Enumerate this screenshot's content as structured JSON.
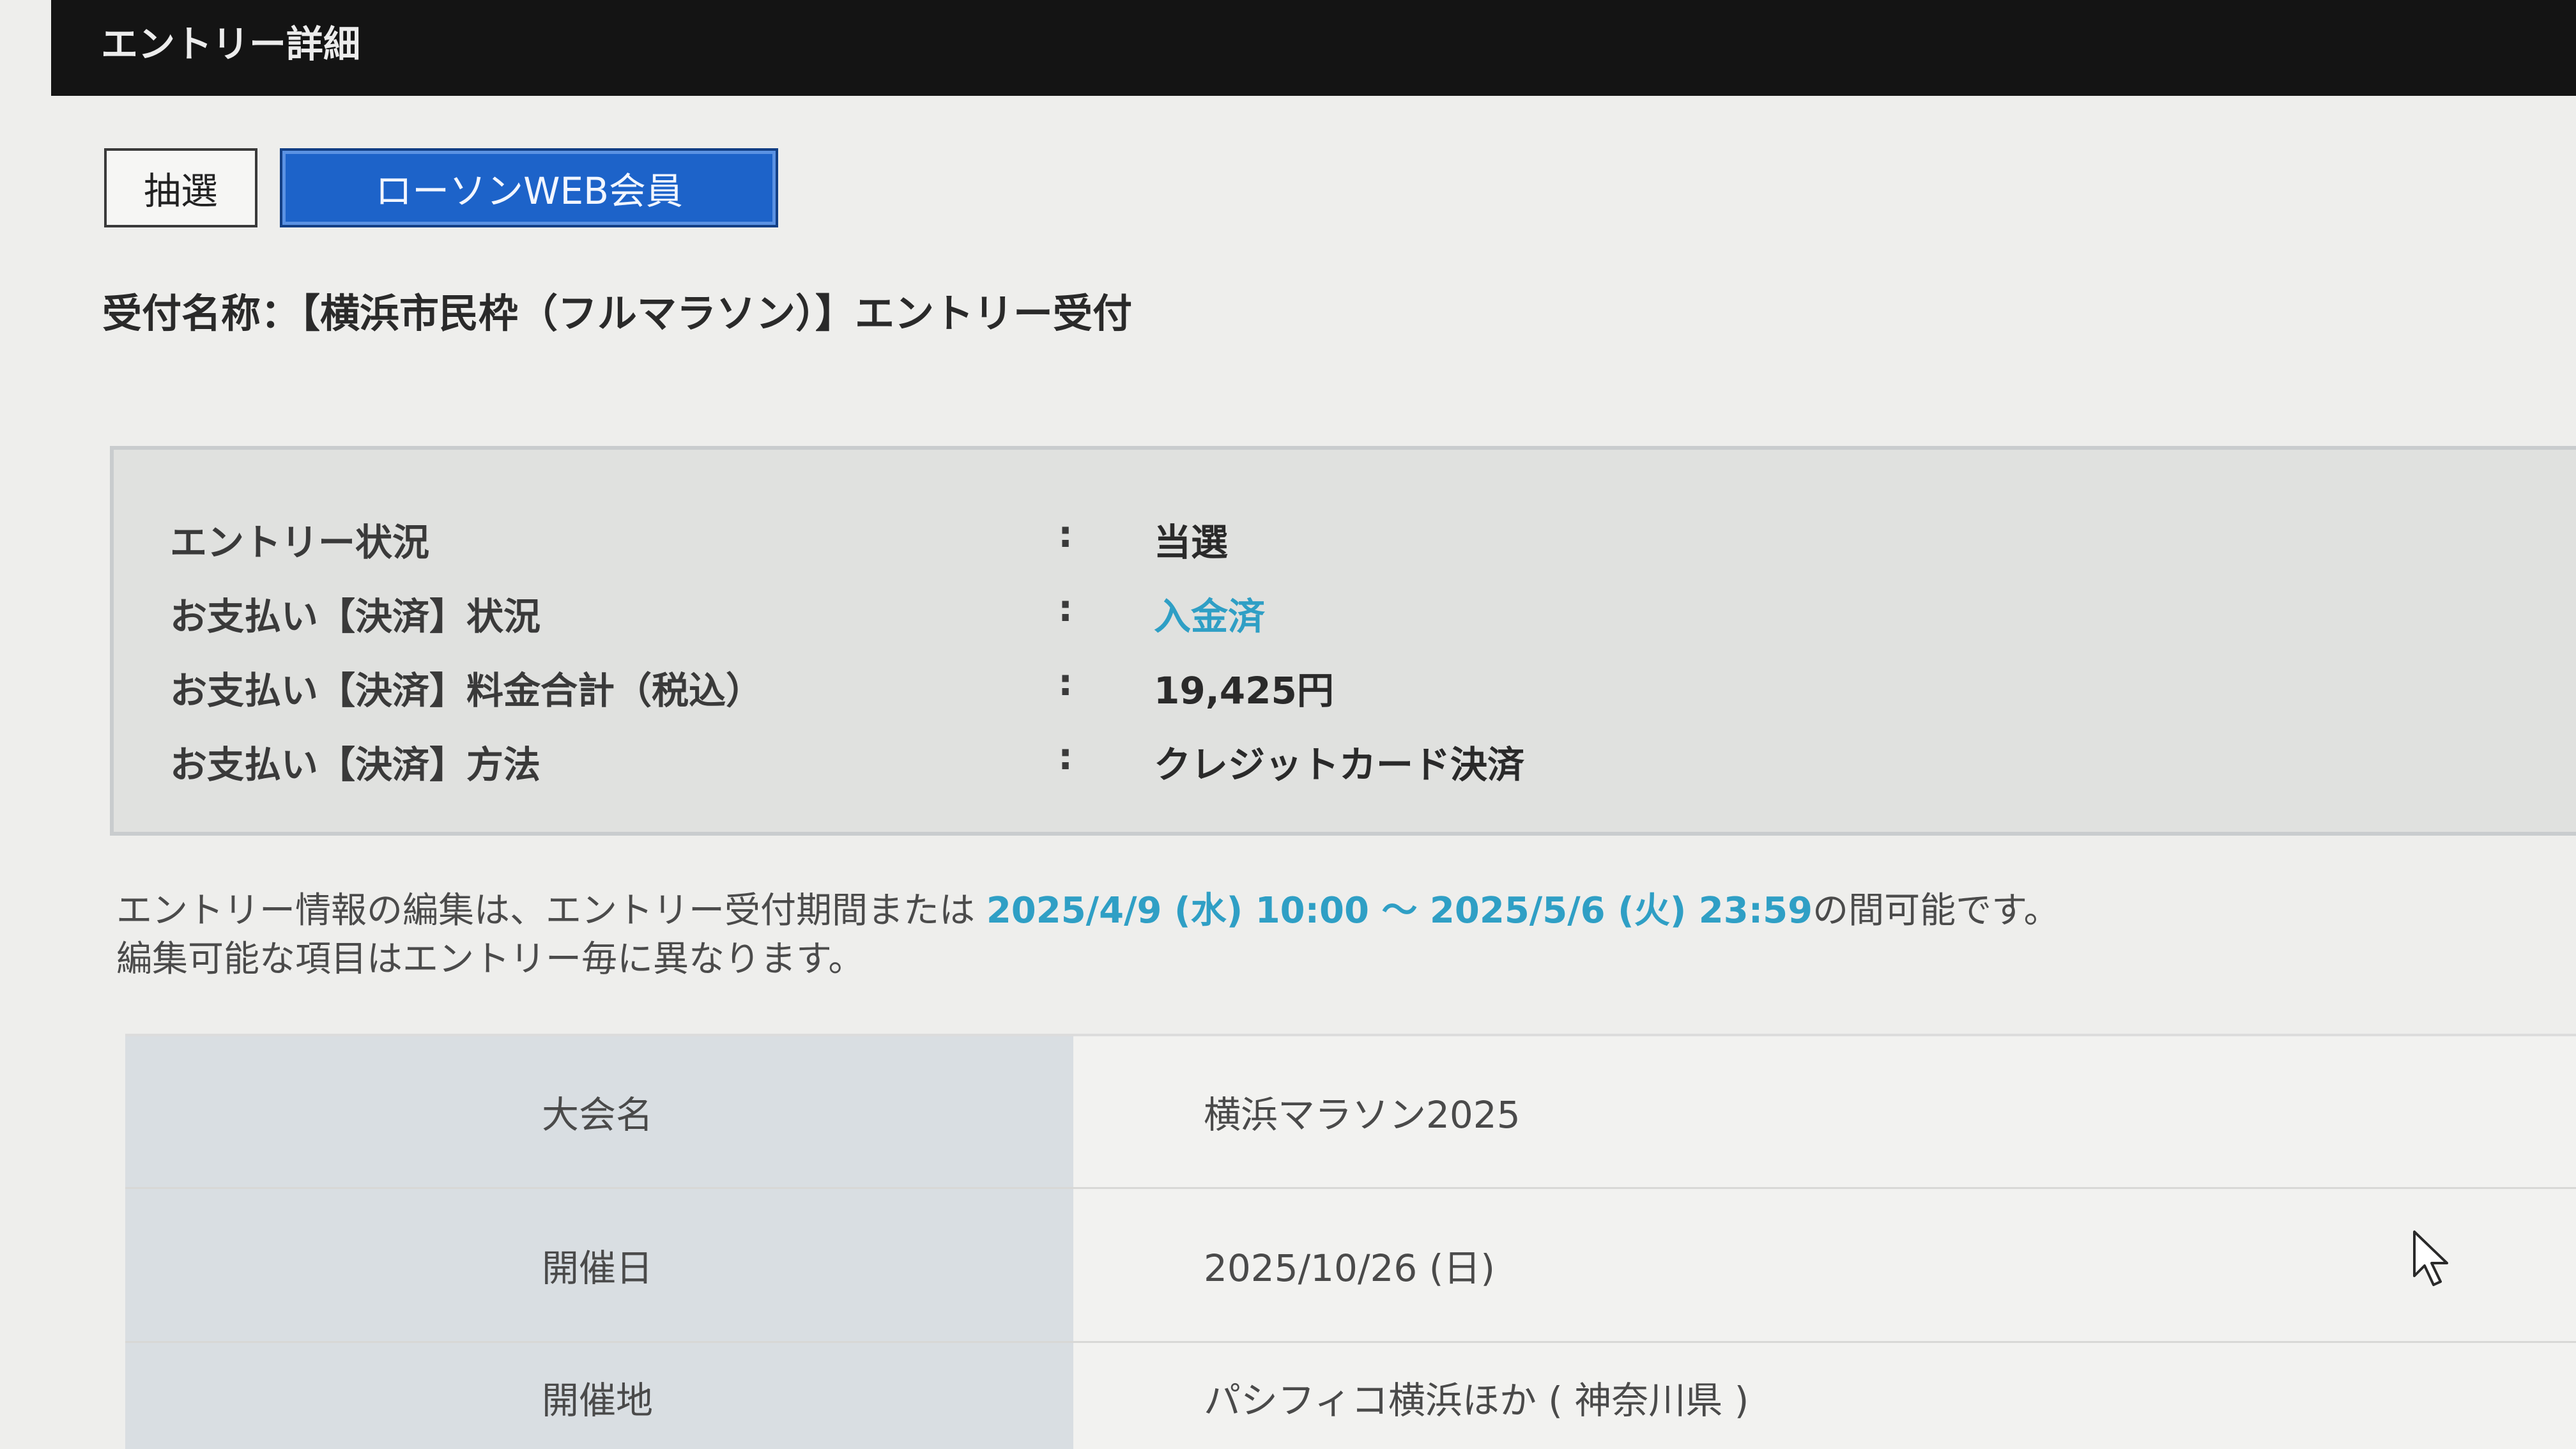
{
  "header": {
    "title": "エントリー詳細"
  },
  "tabs": {
    "lottery": "抽選",
    "lawson_web_member": "ローソンWEB会員"
  },
  "reception": {
    "title": "受付名称：【横浜市民枠（フルマラソン）】エントリー受付"
  },
  "status": {
    "colon": ":",
    "items": [
      {
        "label": "エントリー状況",
        "value": "当選"
      },
      {
        "label": "お支払い【決済】状況",
        "value": "入金済"
      },
      {
        "label": "お支払い【決済】料金合計（税込）",
        "value": "19,425円"
      },
      {
        "label": "お支払い【決済】方法",
        "value": "クレジットカード決済"
      }
    ]
  },
  "notice": {
    "line1_prefix": "エントリー情報の編集は、エントリー受付期間または ",
    "period": "2025/4/9 (水) 10:00 ～ 2025/5/6 (火) 23:59",
    "line1_suffix": "の間可能です。",
    "line2": "編集可能な項目はエントリー毎に異なります。"
  },
  "details": {
    "rows": [
      {
        "label": "大会名",
        "value": "横浜マラソン2025"
      },
      {
        "label": "開催日",
        "value": "2025/10/26 (日)"
      },
      {
        "label": "開催地",
        "value": "パシフィコ横浜ほか ( 神奈川県 )"
      }
    ]
  },
  "colors": {
    "header_bg": "#141414",
    "active_tab": "#1d63c9",
    "link": "#2f9fc5",
    "status_box_bg": "#e0e1df",
    "detail_key_bg": "#d9dee2"
  },
  "icons": {
    "cursor": "mouse-pointer-icon"
  }
}
